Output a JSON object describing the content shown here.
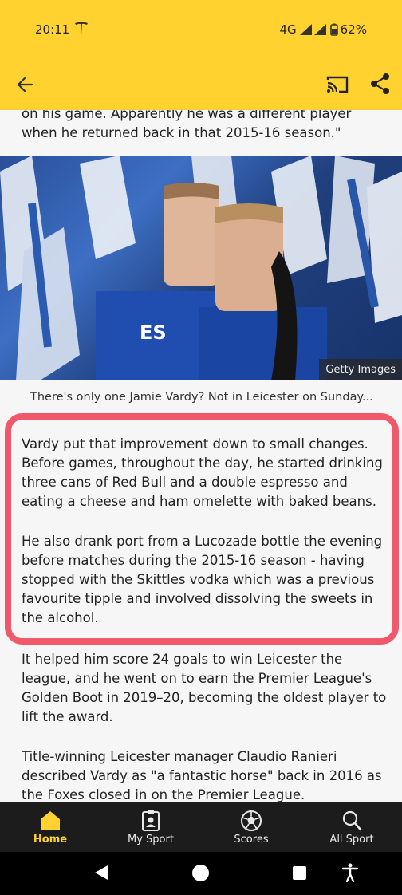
{
  "status_bar": {
    "time": "20:11",
    "network": "4G",
    "battery": "62%"
  },
  "app_bar": {
    "back_icon": "arrow-left-icon",
    "cast_icon": "cast-icon",
    "share_icon": "share-icon"
  },
  "article": {
    "paragraph_top": "on his game. Apparently he was a different player when he returned back in that 2015-16 season.\"",
    "image_credit": "Getty Images",
    "image_caption": "There's only one Jamie Vardy? Not in Leicester on Sunday...",
    "paragraph_1": "Vardy put that improvement down to small changes. Before games, throughout the day, he started drinking three cans of Red Bull and a double espresso and eating a cheese and ham omelette with baked beans.",
    "paragraph_2": "He also drank port from a Lucozade bottle the evening before matches during the 2015-16 season - having stopped with the Skittles vodka which was a previous favourite tipple and involved dissolving the sweets in the alcohol.",
    "paragraph_3": "It helped him score 24 goals to win Leicester the league, and he went on to earn the Premier League's Golden Boot in 2019–20, becoming the oldest player to lift the award.",
    "paragraph_4": "Title-winning Leicester manager Claudio Ranieri described Vardy as \"a fantastic horse\" back in 2016 as the Foxes closed in on the Premier League."
  },
  "bottom_nav": {
    "items": [
      {
        "label": "Home",
        "icon": "home-icon",
        "active": true
      },
      {
        "label": "My Sport",
        "icon": "my-sport-icon",
        "active": false
      },
      {
        "label": "Scores",
        "icon": "football-icon",
        "active": false
      },
      {
        "label": "All Sport",
        "icon": "search-icon",
        "active": false
      }
    ]
  },
  "colors": {
    "brand_yellow": "#ffd230",
    "highlight_red": "#f0596b",
    "nav_background": "#1c1c1c"
  }
}
